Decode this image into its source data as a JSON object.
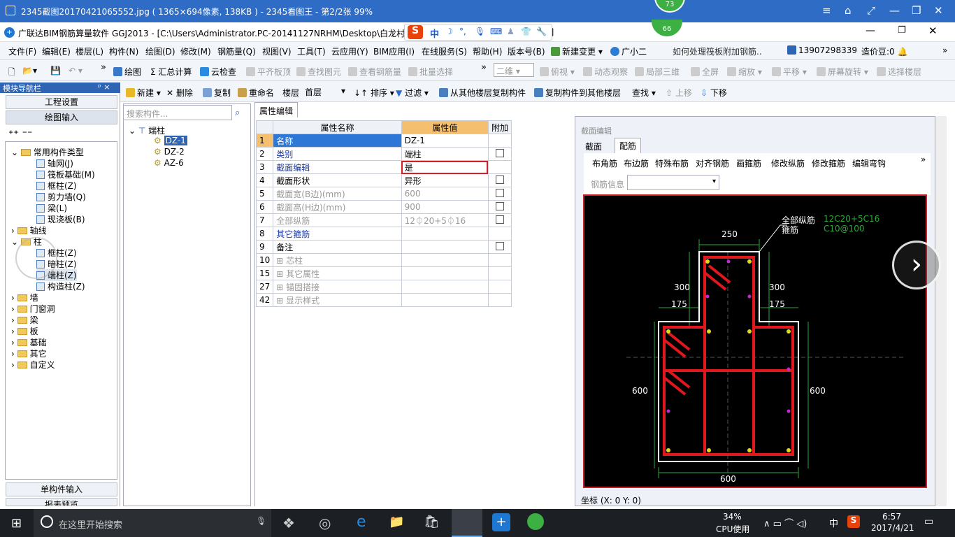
{
  "viewer": {
    "title": "2345截图20170421065552.jpg ( 1365×694像素, 138KB ) - 2345看图王 - 第2/2张 99%",
    "badge": "73",
    "badge2": "66"
  },
  "app": {
    "title": "广联达BIM钢筋算量软件 GGJ2013 - [C:\\Users\\Administrator.PC-20141127NRHM\\Desktop\\白龙村-4",
    "title_tail": "2]"
  },
  "ime": {
    "zh": "中",
    "moon": "☽",
    "dot": "°,"
  },
  "menu": [
    "文件(F)",
    "编辑(E)",
    "楼层(L)",
    "构件(N)",
    "绘图(D)",
    "修改(M)",
    "钢筋量(Q)",
    "视图(V)",
    "工具(T)",
    "云应用(Y)",
    "BIM应用(I)",
    "在线服务(S)",
    "帮助(H)",
    "版本号(B)",
    "新建变更",
    "广小二",
    "如何处理筏板附加钢筋..",
    "13907298339",
    "造价豆:0"
  ],
  "toolbar1": [
    "绘图",
    "Σ 汇总计算",
    "云检查",
    "平齐板顶",
    "查找图元",
    "查看钢筋量",
    "批量选择",
    "二维",
    "俯视",
    "动态观察",
    "局部三维",
    "全屏",
    "缩放",
    "平移",
    "屏幕旋转",
    "选择楼层"
  ],
  "toolbar2": [
    "新建",
    "删除",
    "复制",
    "重命名",
    "楼层",
    "首层",
    "排序",
    "过滤",
    "从其他楼层复制构件",
    "复制构件到其他楼层",
    "查找",
    "上移",
    "下移"
  ],
  "nav": {
    "header": "模块导航栏",
    "pin": "ᵖ ×",
    "btn_setup": "工程设置",
    "btn_draw": "绘图输入",
    "tree": [
      "常用构件类型",
      "轴网(J)",
      "筏板基础(M)",
      "框柱(Z)",
      "剪力墙(Q)",
      "梁(L)",
      "现浇板(B)",
      "轴线",
      "柱",
      "框柱(Z)",
      "暗柱(Z)",
      "端柱(Z)",
      "构造柱(Z)",
      "墙",
      "门窗洞",
      "梁",
      "板",
      "基础",
      "其它",
      "自定义"
    ],
    "btn_single": "单构件输入",
    "btn_report": "报表预览"
  },
  "components": {
    "search_placeholder": "搜索构件...",
    "root": "端柱",
    "items": [
      "DZ-1",
      "DZ-2",
      "AZ-6"
    ]
  },
  "props": {
    "tab": "属性编辑",
    "headers": [
      "属性名称",
      "属性值",
      "附加"
    ],
    "rows": [
      {
        "no": "1",
        "name": "名称",
        "value": "DZ-1"
      },
      {
        "no": "2",
        "name": "类别",
        "value": "端柱"
      },
      {
        "no": "3",
        "name": "截面编辑",
        "value": "是"
      },
      {
        "no": "4",
        "name": "截面形状",
        "value": "异形"
      },
      {
        "no": "5",
        "name": "截面宽(B边)(mm)",
        "value": "600"
      },
      {
        "no": "6",
        "name": "截面高(H边)(mm)",
        "value": "900"
      },
      {
        "no": "7",
        "name": "全部纵筋",
        "value": "12⏀20+5⏀16"
      },
      {
        "no": "8",
        "name": "其它箍筋",
        "value": ""
      },
      {
        "no": "9",
        "name": "备注",
        "value": ""
      },
      {
        "no": "10",
        "name": "芯柱",
        "value": ""
      },
      {
        "no": "15",
        "name": "其它属性",
        "value": ""
      },
      {
        "no": "27",
        "name": "锚固搭接",
        "value": ""
      },
      {
        "no": "42",
        "name": "显示样式",
        "value": ""
      }
    ]
  },
  "editor": {
    "title": "截面编辑",
    "tabs": [
      "截面",
      "配筋"
    ],
    "tools": [
      "布角筋",
      "布边筋",
      "特殊布筋",
      "对齐钢筋",
      "画箍筋",
      "修改纵筋",
      "修改箍筋",
      "编辑弯钩"
    ],
    "rebar_info_label": "钢筋信息",
    "label_all": "全部纵筋",
    "label_stirrup": "箍筋",
    "val_all": "12C20+5C16",
    "val_stirrup": "C10@100",
    "dims": [
      "250",
      "300",
      "300",
      "175",
      "175",
      "600",
      "600",
      "600"
    ],
    "coords": "坐标 (X: 0 Y: 0)"
  },
  "taskbar": {
    "search": "在这里开始搜索",
    "cpu": "34%",
    "cpu_label": "CPU使用",
    "time": "6:57",
    "date": "2017/4/21",
    "lang": "中"
  }
}
